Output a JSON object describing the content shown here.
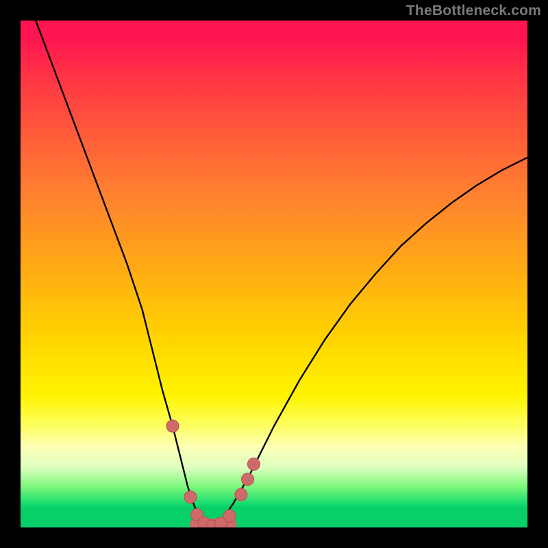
{
  "attribution": "TheBottleneck.com",
  "colors": {
    "background": "#000000",
    "curve_stroke": "#000000",
    "marker_fill": "#cf6a6b",
    "marker_stroke": "#b84f50",
    "gradient_top": "#ff1650",
    "gradient_mid": "#fff400",
    "gradient_bottom": "#08d068"
  },
  "chart_data": {
    "type": "line",
    "title": "",
    "xlabel": "",
    "ylabel": "",
    "xlim": [
      0,
      100
    ],
    "ylim": [
      0,
      100
    ],
    "grid": false,
    "legend": false,
    "series": [
      {
        "name": "bottleneck-curve",
        "x": [
          0,
          3,
          6,
          9,
          12,
          15,
          18,
          21,
          24,
          26,
          28,
          30,
          31,
          32,
          33,
          34,
          35,
          36,
          37,
          38,
          39,
          40,
          42,
          45,
          50,
          55,
          60,
          65,
          70,
          75,
          80,
          85,
          90,
          95,
          100
        ],
        "y": [
          108,
          100,
          92,
          84,
          76,
          68,
          60,
          52,
          43,
          35,
          27,
          20,
          16,
          12,
          8,
          5,
          2.5,
          1,
          0.2,
          0,
          0.5,
          1.8,
          4.8,
          10,
          20,
          29,
          37,
          44,
          50,
          55.5,
          60,
          64,
          67.5,
          70.5,
          73
        ]
      }
    ],
    "markers": [
      {
        "x": 30.0,
        "y": 20.0
      },
      {
        "x": 33.5,
        "y": 6.0
      },
      {
        "x": 34.8,
        "y": 2.5
      },
      {
        "x": 36.2,
        "y": 0.9
      },
      {
        "x": 37.8,
        "y": 0.3
      },
      {
        "x": 39.5,
        "y": 0.8
      },
      {
        "x": 41.2,
        "y": 2.3
      },
      {
        "x": 43.5,
        "y": 6.5
      },
      {
        "x": 44.8,
        "y": 9.5
      },
      {
        "x": 46.0,
        "y": 12.5
      }
    ],
    "valley_floor": {
      "start_x": 34.5,
      "end_x": 41.5,
      "y": 0.6
    }
  }
}
